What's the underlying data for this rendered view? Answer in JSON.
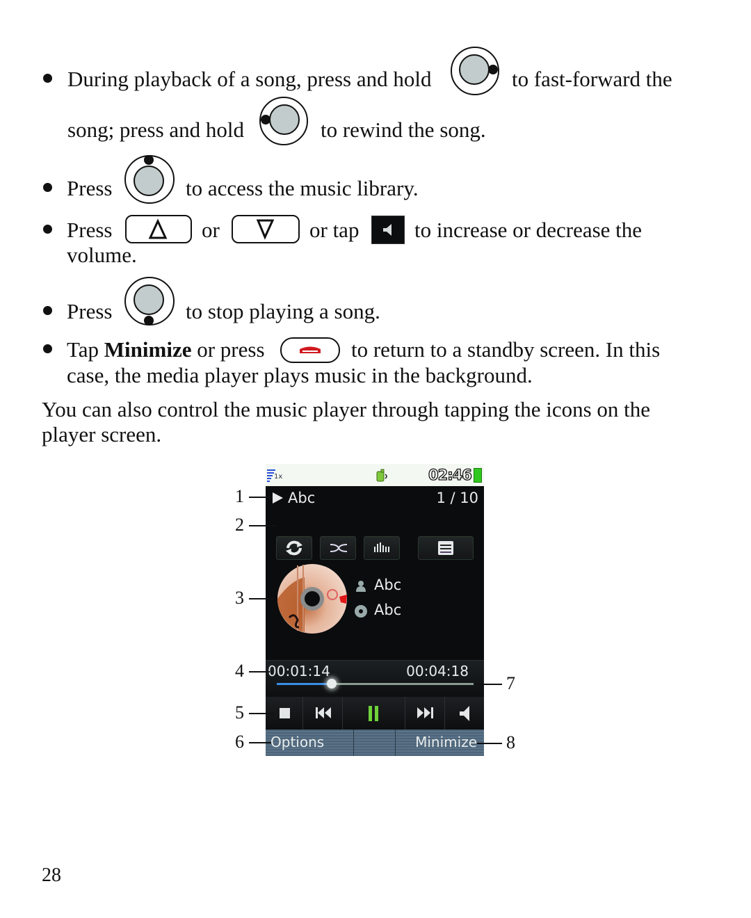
{
  "bullets": [
    {
      "line1_before": "During playback of a song, press and hold",
      "icon": "nav-key-right",
      "line1_after": "to fast-forward the",
      "line2_before": "song; press and hold",
      "icon2": "nav-key-left",
      "line2_after": "to rewind the song."
    },
    {
      "before": "Press",
      "icon": "nav-key-up",
      "after": "to access the music library."
    },
    {
      "before": "Press",
      "key1": "Δ",
      "mid1": "or",
      "key2": "∇",
      "mid2": "or tap",
      "icon": "speaker-icon",
      "after": "to increase or decrease the",
      "line2": "volume."
    },
    {
      "before": "Press",
      "icon": "nav-key-down",
      "after": "to stop playing a song."
    },
    {
      "before": "Tap",
      "bold": "Minimize",
      "mid": "or press",
      "icon": "end-call-key",
      "after": "to return to a standby screen. In this",
      "line2": "case, the media player plays music in the background."
    }
  ],
  "paragraph": {
    "line1": "You can also control the music player through tapping the icons on the",
    "line2": "player screen."
  },
  "phone": {
    "status": {
      "signal_label": "1x",
      "time": "02:46",
      "battery_color": "#2fc81e"
    },
    "now_playing": {
      "title": "Abc",
      "track_position": "1 / 10"
    },
    "toolbar": [
      "repeat-icon",
      "shuffle-icon",
      "equalizer-icon",
      "playlist-icon"
    ],
    "artist": "Abc",
    "album": "Abc",
    "elapsed": "00:01:14",
    "duration": "00:04:18",
    "progress": 0.28,
    "controls": [
      "stop-icon",
      "previous-icon",
      "pause-icon",
      "next-icon",
      "volume-icon"
    ],
    "softkeys": {
      "left": "Options",
      "right": "Minimize"
    },
    "accent_progress": "#3a8ee8",
    "accent_pause": "#6fd23a"
  },
  "callouts": {
    "c1": "1",
    "c2": "2",
    "c3": "3",
    "c4": "4",
    "c5": "5",
    "c6": "6",
    "c7": "7",
    "c8": "8"
  },
  "page_number": "28"
}
